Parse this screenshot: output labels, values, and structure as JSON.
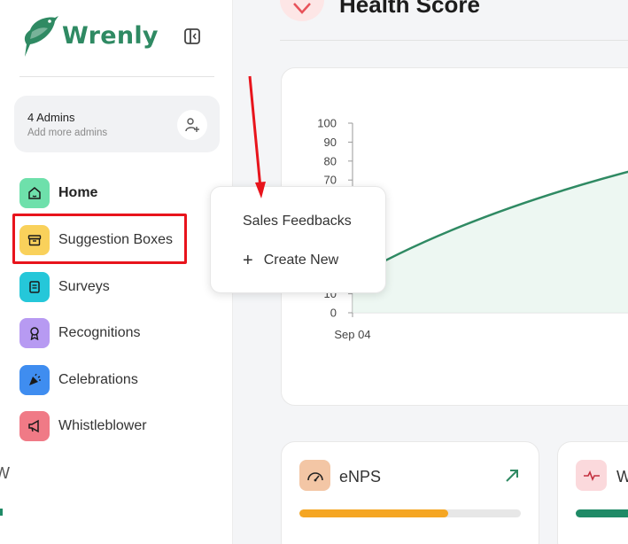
{
  "app": {
    "name": "Wrenly",
    "brand_color": "#2f8a63"
  },
  "admins": {
    "title": "4 Admins",
    "subtitle": "Add more admins",
    "icon": "add-user-icon"
  },
  "nav": {
    "items": [
      {
        "label": "Home",
        "icon": "home-icon",
        "color": "#6ee0ab",
        "active": true
      },
      {
        "label": "Suggestion Boxes",
        "icon": "archive-box-icon",
        "color": "#f9d15b",
        "active": false
      },
      {
        "label": "Surveys",
        "icon": "survey-icon",
        "color": "#25c7d9",
        "active": false
      },
      {
        "label": "Recognitions",
        "icon": "award-icon",
        "color": "#b79af2",
        "active": false
      },
      {
        "label": "Celebrations",
        "icon": "party-popper-icon",
        "color": "#3f8df0",
        "active": false
      },
      {
        "label": "Whistleblower",
        "icon": "megaphone-icon",
        "color": "#f07a86",
        "active": false
      }
    ]
  },
  "header": {
    "title": "Health Score",
    "icon": "heart-icon"
  },
  "dropdown": {
    "items": [
      {
        "label": "Sales Feedbacks"
      },
      {
        "label": "Create New",
        "icon": "plus-icon"
      }
    ]
  },
  "chart_data": {
    "type": "line",
    "title": "",
    "xlabel": "",
    "ylabel": "",
    "yticks": [
      0,
      10,
      70,
      80,
      90,
      100
    ],
    "ylim": [
      0,
      100
    ],
    "categories": [
      "Sep 04"
    ],
    "line_color": "#2f8a63"
  },
  "cards": [
    {
      "title": "eNPS",
      "icon": "gauge-icon",
      "icon_bg": "#f3c6a5",
      "progress": 0.67,
      "progress_color": "#f5a623",
      "trend_icon": "arrow-up-right-icon"
    },
    {
      "title": "W",
      "icon": "pulse-icon",
      "icon_bg": "#fbd9dc",
      "progress_color": "#1f8a66"
    }
  ],
  "annotation": {
    "highlight_color": "#e8141c"
  }
}
